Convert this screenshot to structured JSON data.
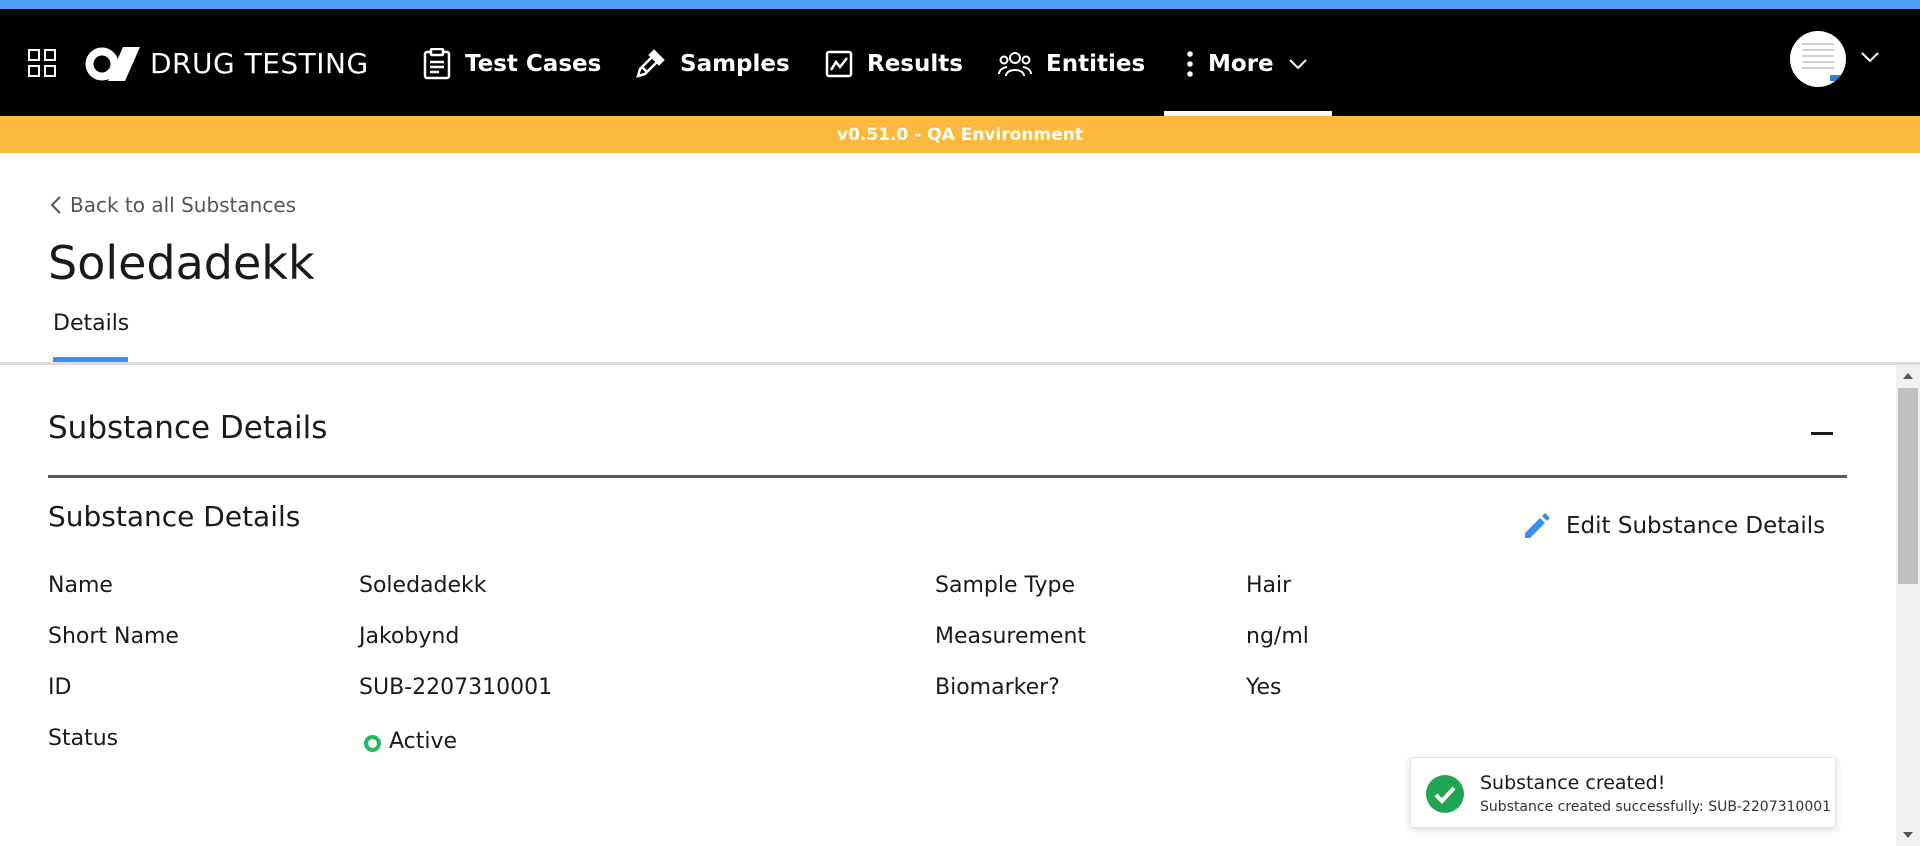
{
  "colors": {
    "top_strip": "#4da3f7",
    "navbar_bg": "#000000",
    "env_banner_bg": "#fbb93d",
    "accent_blue": "#3b8df0",
    "status_active": "#28b463",
    "toast_success": "#21a453"
  },
  "app": {
    "name": "DRUG TESTING"
  },
  "nav": {
    "items": [
      {
        "label": "Test Cases",
        "icon": "clipboard-icon"
      },
      {
        "label": "Samples",
        "icon": "pipette-icon"
      },
      {
        "label": "Results",
        "icon": "line-chart-icon"
      },
      {
        "label": "Entities",
        "icon": "users-icon"
      },
      {
        "label": "More",
        "icon": "more-vertical-icon"
      }
    ],
    "active": "More"
  },
  "env_banner": {
    "text": "v0.51.0 - QA Environment"
  },
  "page": {
    "back_link": "Back to all Substances",
    "title": "Soledadekk",
    "tabs": [
      "Details"
    ],
    "active_tab": "Details"
  },
  "section": {
    "title": "Substance Details",
    "subsection_title": "Substance Details",
    "edit_label": "Edit Substance Details",
    "fields_left": [
      {
        "label": "Name",
        "value": "Soledadekk"
      },
      {
        "label": "Short Name",
        "value": "Jakobynd"
      },
      {
        "label": "ID",
        "value": "SUB-2207310001"
      },
      {
        "label": "Status",
        "value": "Active"
      }
    ],
    "fields_right": [
      {
        "label": "Sample Type",
        "value": "Hair"
      },
      {
        "label": "Measurement",
        "value": "ng/ml"
      },
      {
        "label": "Biomarker?",
        "value": "Yes"
      }
    ]
  },
  "toast": {
    "title": "Substance created!",
    "message": "Substance created successfully: SUB-2207310001"
  }
}
